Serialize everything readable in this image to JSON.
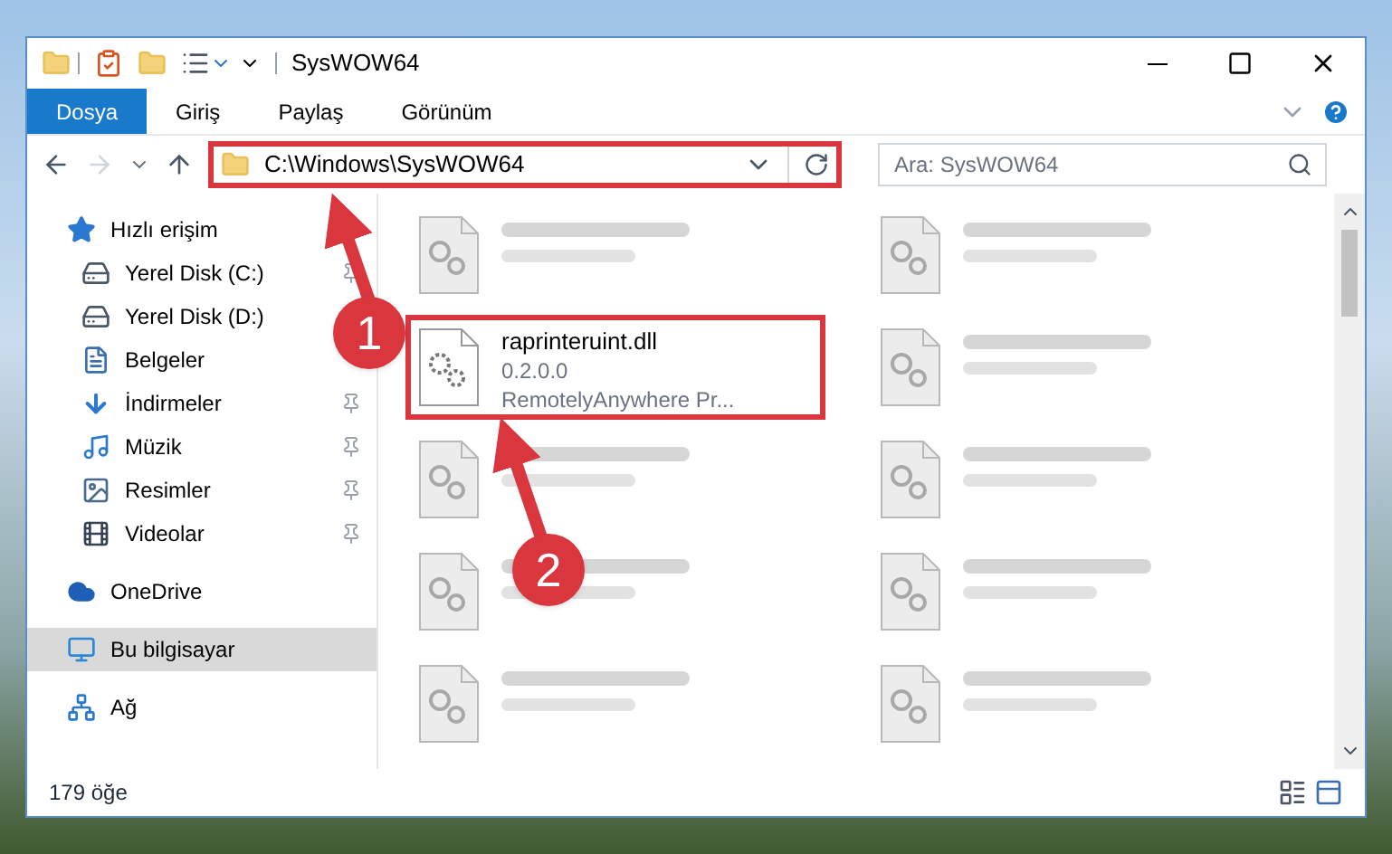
{
  "window": {
    "title": "SysWOW64"
  },
  "ribbon_tabs": [
    {
      "label": "Dosya",
      "selected": true
    },
    {
      "label": "Giriş",
      "selected": false
    },
    {
      "label": "Paylaş",
      "selected": false
    },
    {
      "label": "Görünüm",
      "selected": false
    }
  ],
  "address_bar": {
    "value": "C:\\Windows\\SysWOW64",
    "highlighted": true
  },
  "search": {
    "placeholder": "Ara: SysWOW64"
  },
  "sidebar": {
    "items": [
      {
        "label": "Hızlı erişim",
        "kind": "star",
        "selected": false,
        "children": [
          {
            "label": "Yerel Disk (C:)",
            "kind": "drive",
            "pinned": true,
            "selected": false
          },
          {
            "label": "Yerel Disk (D:)",
            "kind": "drive",
            "pinned": false,
            "selected": false
          },
          {
            "label": "Belgeler",
            "kind": "documents",
            "pinned": false,
            "selected": false
          },
          {
            "label": "İndirmeler",
            "kind": "downloads",
            "pinned": true,
            "selected": false
          },
          {
            "label": "Müzik",
            "kind": "music",
            "pinned": true,
            "selected": false
          },
          {
            "label": "Resimler",
            "kind": "pictures",
            "pinned": true,
            "selected": false
          },
          {
            "label": "Videolar",
            "kind": "videos",
            "pinned": true,
            "selected": false
          }
        ]
      },
      {
        "label": "OneDrive",
        "kind": "cloud",
        "selected": false
      },
      {
        "label": "Bu bilgisayar",
        "kind": "computer",
        "selected": true
      },
      {
        "label": "Ağ",
        "kind": "network",
        "selected": false
      }
    ]
  },
  "files": [
    {
      "kind": "blurred",
      "highlighted": false
    },
    {
      "kind": "blurred",
      "highlighted": false
    },
    {
      "kind": "detailed",
      "name": "raprinteruint.dll",
      "version": "0.2.0.0",
      "company": "RemotelyAnywhere Pr...",
      "highlighted": true
    },
    {
      "kind": "blurred",
      "highlighted": false
    },
    {
      "kind": "blurred",
      "highlighted": false
    },
    {
      "kind": "blurred",
      "highlighted": false
    },
    {
      "kind": "blurred",
      "highlighted": false
    },
    {
      "kind": "blurred",
      "highlighted": false
    },
    {
      "kind": "blurred",
      "highlighted": false
    },
    {
      "kind": "blurred",
      "highlighted": false
    }
  ],
  "status_bar": {
    "count": "179 öğe"
  },
  "annotations": [
    {
      "number": "1"
    },
    {
      "number": "2"
    }
  ]
}
